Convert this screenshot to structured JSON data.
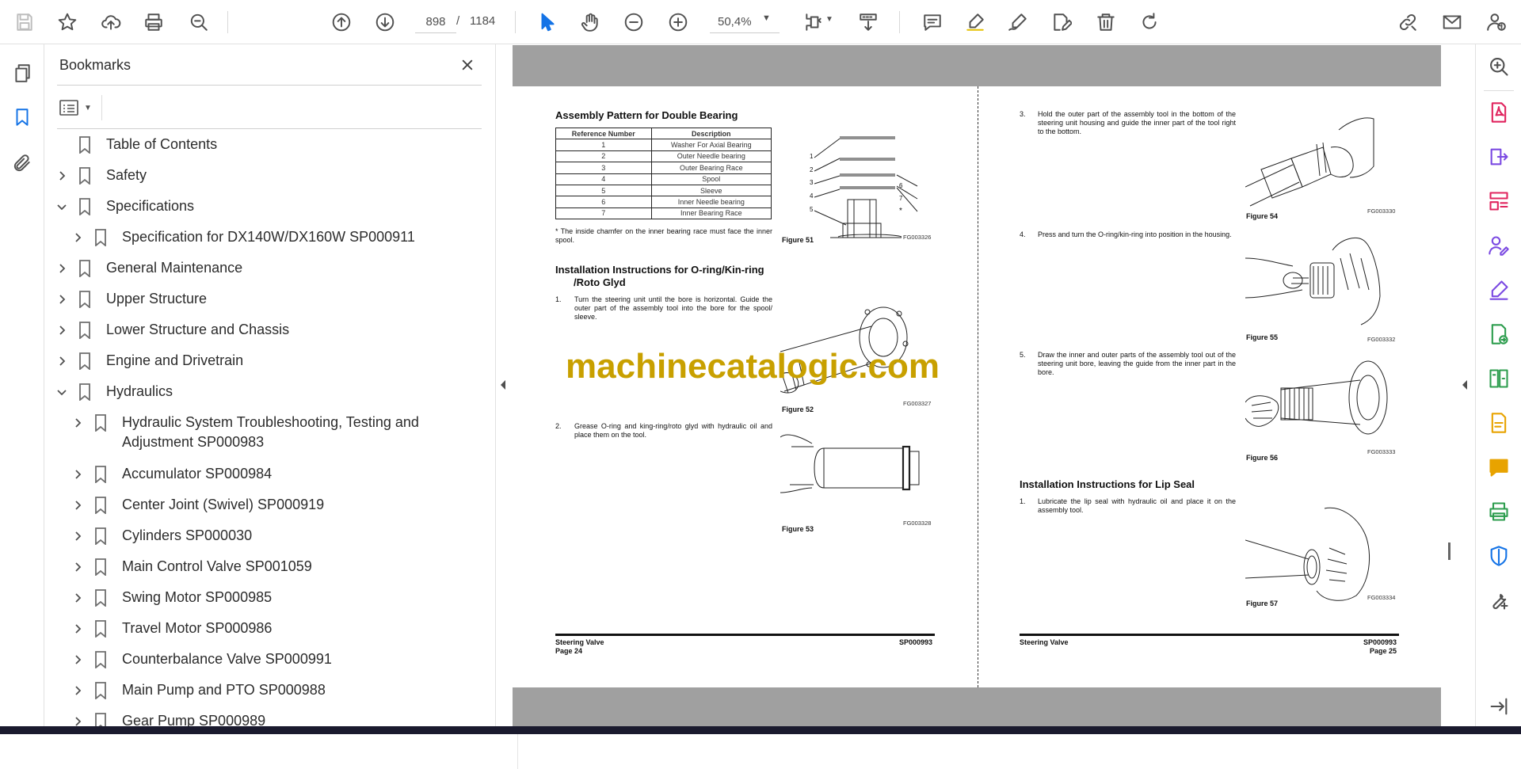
{
  "toolbar": {
    "current_page": "898",
    "page_separator": "/",
    "total_pages": "1184",
    "zoom": "50,4%"
  },
  "bookmarks": {
    "title": "Bookmarks",
    "items": [
      {
        "label": "Table of Contents",
        "level": 0,
        "expander": "none"
      },
      {
        "label": "Safety",
        "level": 0,
        "expander": "collapsed"
      },
      {
        "label": "Specifications",
        "level": 0,
        "expander": "expanded"
      },
      {
        "label": "Specification for DX140W/DX160W SP000911",
        "level": 1,
        "expander": "collapsed"
      },
      {
        "label": "General Maintenance",
        "level": 0,
        "expander": "collapsed"
      },
      {
        "label": "Upper Structure",
        "level": 0,
        "expander": "collapsed"
      },
      {
        "label": "Lower Structure and Chassis",
        "level": 0,
        "expander": "collapsed"
      },
      {
        "label": "Engine and Drivetrain",
        "level": 0,
        "expander": "collapsed"
      },
      {
        "label": "Hydraulics",
        "level": 0,
        "expander": "expanded"
      },
      {
        "label": "Hydraulic System Troubleshooting, Testing and",
        "label2": "Adjustment SP000983",
        "level": 1,
        "expander": "collapsed"
      },
      {
        "label": "Accumulator SP000984",
        "level": 1,
        "expander": "collapsed"
      },
      {
        "label": "Center Joint (Swivel) SP000919",
        "level": 1,
        "expander": "collapsed"
      },
      {
        "label": "Cylinders SP000030",
        "level": 1,
        "expander": "collapsed"
      },
      {
        "label": "Main Control Valve SP001059",
        "level": 1,
        "expander": "collapsed"
      },
      {
        "label": "Swing Motor SP000985",
        "level": 1,
        "expander": "collapsed"
      },
      {
        "label": "Travel Motor SP000986",
        "level": 1,
        "expander": "collapsed"
      },
      {
        "label": "Counterbalance Valve SP000991",
        "level": 1,
        "expander": "collapsed"
      },
      {
        "label": "Main Pump and PTO SP000988",
        "level": 1,
        "expander": "collapsed"
      },
      {
        "label": "Gear Pump SP000989",
        "level": 1,
        "expander": "collapsed"
      }
    ]
  },
  "left_page": {
    "heading1": "Assembly Pattern for Double Bearing",
    "table_headers": [
      "Reference Number",
      "Description"
    ],
    "table_rows": [
      [
        "1",
        "Washer For Axial Bearing"
      ],
      [
        "2",
        "Outer Needle bearing"
      ],
      [
        "3",
        "Outer Bearing Race"
      ],
      [
        "4",
        "Spool"
      ],
      [
        "5",
        "Sleeve"
      ],
      [
        "6",
        "Inner Needle bearing"
      ],
      [
        "7",
        "Inner Bearing Race"
      ]
    ],
    "note": "*  The inside chamfer on the inner bearing race must face the inner spool.",
    "fig51_caption": "Figure 51",
    "fig51_code": "FG003326",
    "fig51_labels": [
      "1",
      "2",
      "3",
      "4",
      "5",
      "6",
      "7",
      "*"
    ],
    "heading2_line1": "Installation Instructions for O-ring/Kin-ring",
    "heading2_line2": "/Roto Glyd",
    "step1_num": "1.",
    "step1_text": "Turn the steering unit until the bore is horizontal. Guide the outer part of the assembly tool into the bore for the spool/ sleeve.",
    "fig52_caption": "Figure 52",
    "fig52_code": "FG003327",
    "step2_num": "2.",
    "step2_text": "Grease O-ring and king-ring/roto glyd with hydraulic oil and place them on the tool.",
    "fig53_caption": "Figure 53",
    "fig53_code": "FG003328",
    "footer_left": "Steering Valve",
    "footer_page": "Page 24",
    "footer_right": "SP000993"
  },
  "right_page": {
    "step3_num": "3.",
    "step3_text": "Hold the outer part of the assembly tool in the bottom of the steering unit housing and guide the inner part of the tool right to the bottom.",
    "fig54_caption": "Figure 54",
    "fig54_code": "FG003330",
    "step4_num": "4.",
    "step4_text": "Press and turn the O-ring/kin-ring into position in the housing.",
    "fig55_caption": "Figure 55",
    "fig55_code": "FG003332",
    "step5_num": "5.",
    "step5_text": "Draw the inner and outer parts of the assembly tool out of the steering unit bore, leaving the guide from the inner part in the bore.",
    "fig56_caption": "Figure 56",
    "fig56_code": "FG003333",
    "heading": "Installation Instructions for Lip Seal",
    "step6_num": "1.",
    "step6_text": "Lubricate the lip seal with hydraulic oil and place it on the assembly tool.",
    "fig57_caption": "Figure 57",
    "fig57_code": "FG003334",
    "footer_left": "Steering Valve",
    "footer_right": "SP000993",
    "footer_page": "Page 25"
  },
  "watermark": "machinecatalogic.com",
  "colors": {
    "accent": "#1473e6",
    "watermark": "#c8a000",
    "page_gray": "#a0a0a0",
    "rail_pink": "#e0245e",
    "rail_purple": "#7b4ae2",
    "rail_green": "#2d9d4e",
    "rail_yellow": "#e8a300"
  }
}
